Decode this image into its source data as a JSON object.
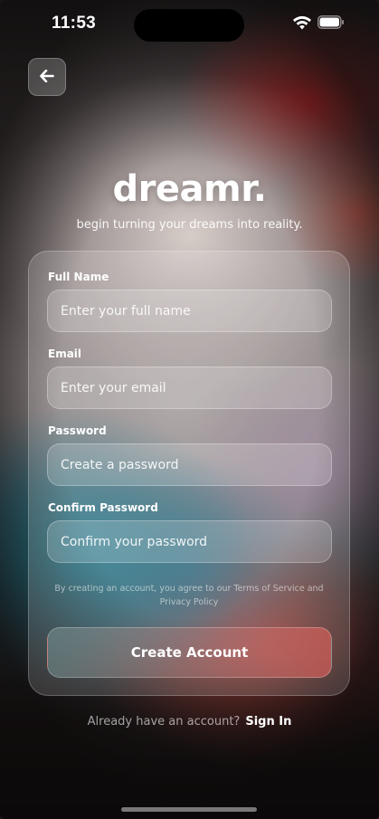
{
  "status_bar": {
    "time": "11:53",
    "wifi_icon": "wifi-icon",
    "battery_icon": "battery-icon"
  },
  "back_button": {
    "icon": "arrow-left-icon"
  },
  "brand": {
    "title": "dreamr.",
    "tagline": "begin turning your dreams into reality."
  },
  "form": {
    "full_name": {
      "label": "Full Name",
      "placeholder": "Enter your full name",
      "value": ""
    },
    "email": {
      "label": "Email",
      "placeholder": "Enter your email",
      "value": ""
    },
    "password": {
      "label": "Password",
      "placeholder": "Create a password",
      "value": ""
    },
    "confirm_password": {
      "label": "Confirm Password",
      "placeholder": "Confirm your password",
      "value": ""
    },
    "terms_prefix": "By creating an account, you agree to our ",
    "terms_link": "Terms of Service",
    "terms_and": " and",
    "privacy_link": "Privacy Policy",
    "submit_label": "Create Account"
  },
  "footer": {
    "prompt": "Already have an account?",
    "signin_label": "Sign In"
  },
  "colors": {
    "text": "#ffffff",
    "accent_red": "#d75f5a",
    "accent_teal": "#1e788c"
  }
}
